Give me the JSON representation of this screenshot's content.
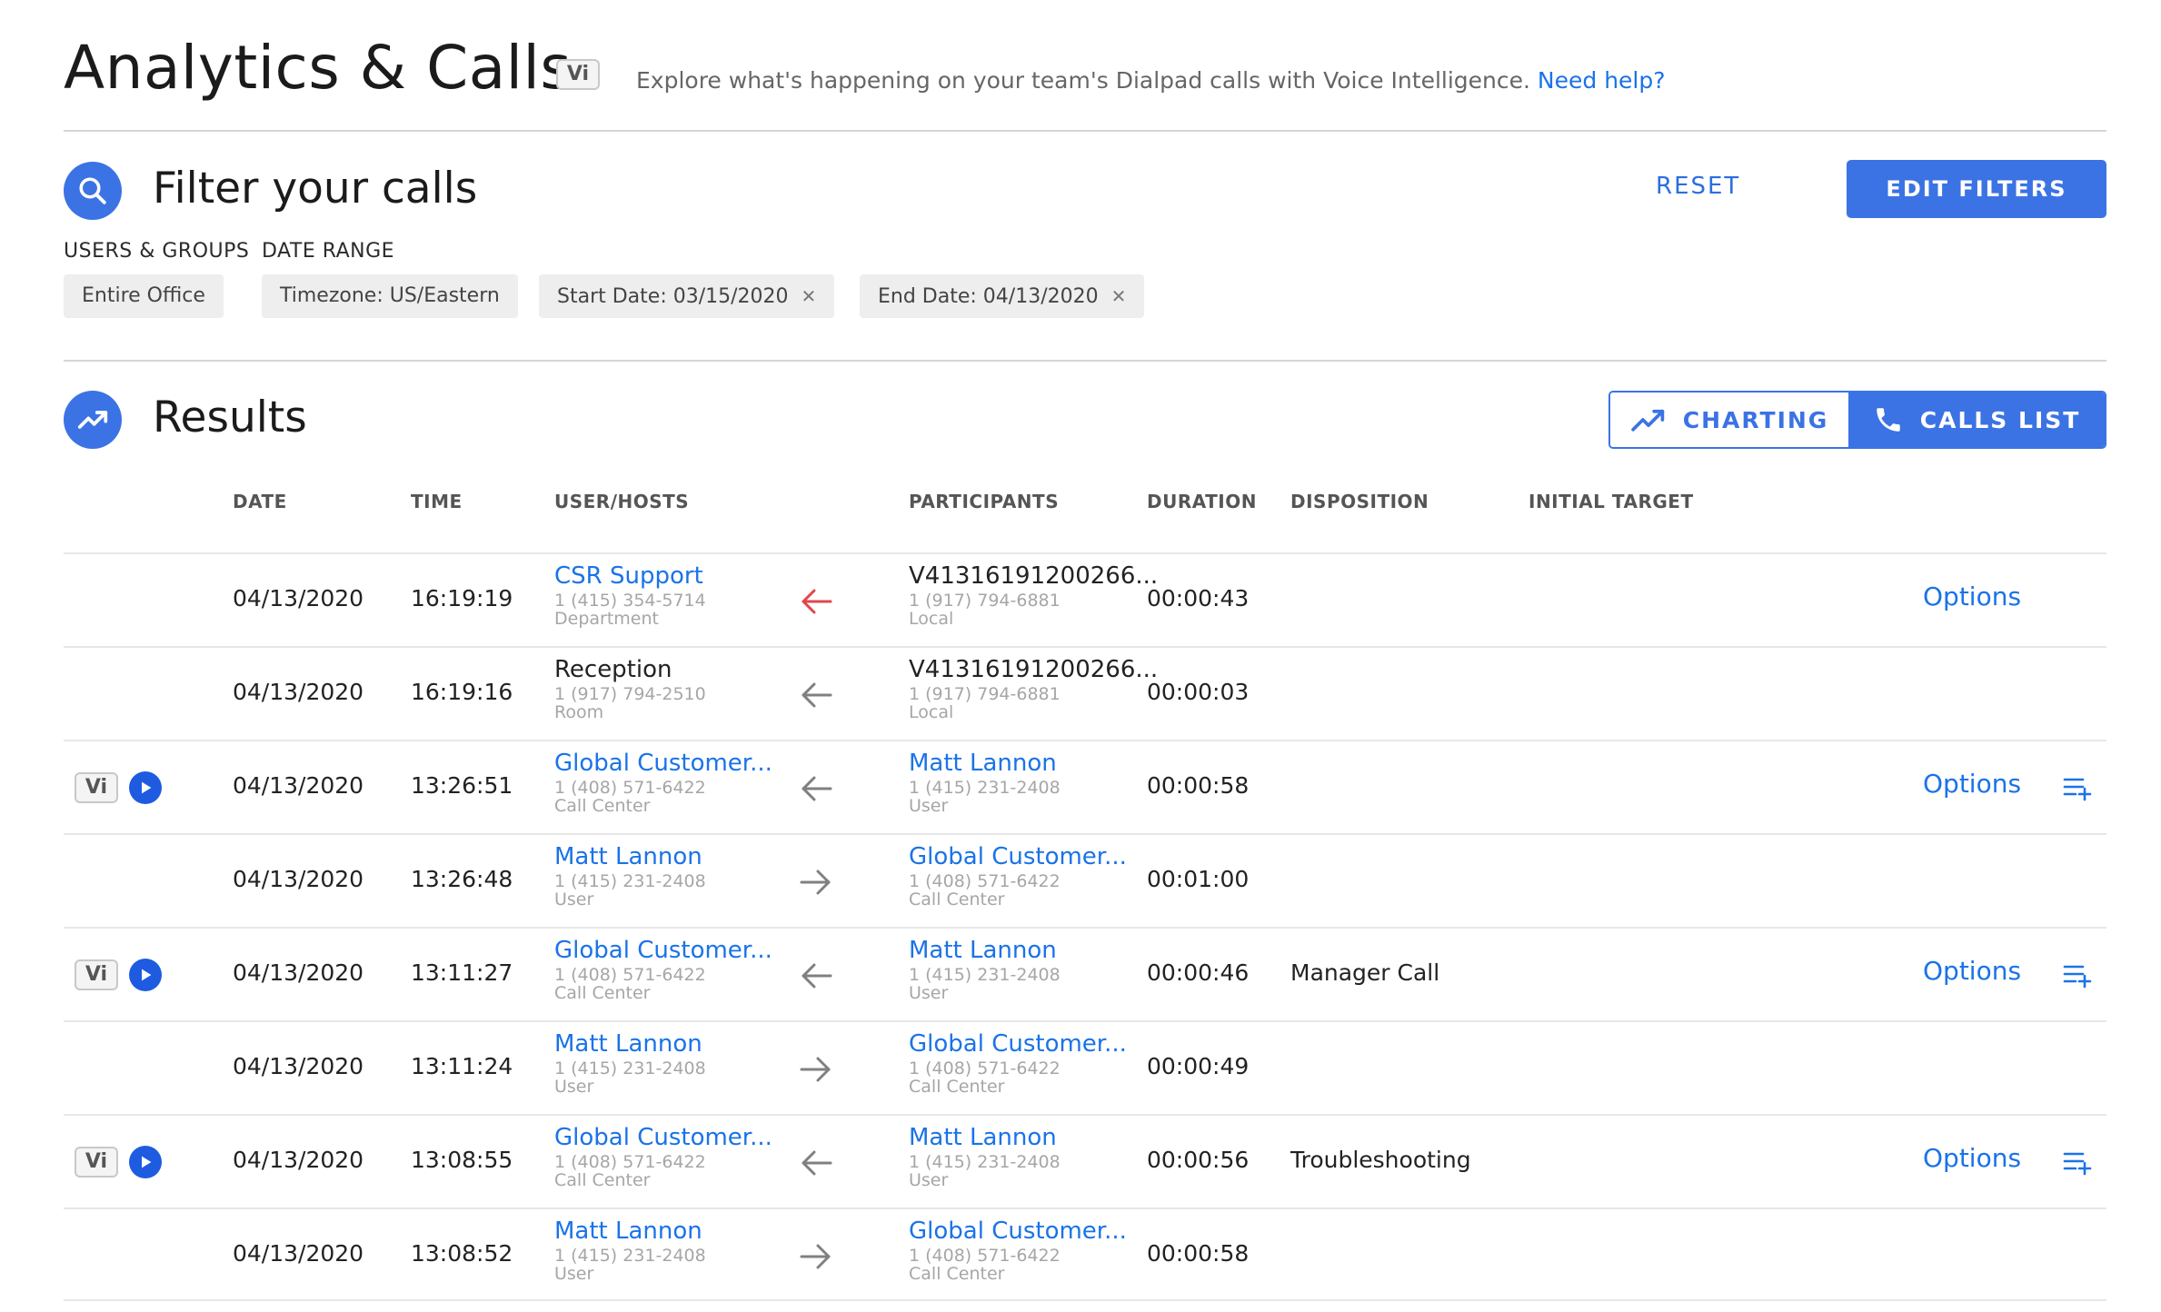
{
  "header": {
    "title": "Analytics & Calls",
    "vi_badge": "Vi",
    "subtitle": "Explore what's happening on your team's Dialpad calls with Voice Intelligence.",
    "help_link": "Need help?"
  },
  "filter": {
    "title": "Filter your calls",
    "reset_label": "RESET",
    "edit_label": "EDIT FILTERS",
    "users_groups_label": "USERS & GROUPS",
    "date_range_label": "DATE RANGE",
    "chips": {
      "office": "Entire Office",
      "timezone": "Timezone:  US/Eastern",
      "start": "Start Date:  03/15/2020",
      "end": "End Date:  04/13/2020"
    }
  },
  "results": {
    "title": "Results",
    "charting_label": "CHARTING",
    "calls_list_label": "CALLS LIST",
    "columns": {
      "date": "DATE",
      "time": "TIME",
      "hosts": "USER/HOSTS",
      "participants": "PARTICIPANTS",
      "duration": "DURATION",
      "disposition": "DISPOSITION",
      "initial_target": "INITIAL TARGET"
    },
    "options_label": "Options",
    "vi_label": "Vi",
    "rows": [
      {
        "date": "04/13/2020",
        "time": "16:19:19",
        "host": "CSR Support",
        "host_phone": "1 (415) 354-5714",
        "host_type": "Department",
        "participant": "V41316191200266...",
        "participant_phone": "1 (917) 794-6881",
        "participant_type": "Local",
        "duration": "00:00:43",
        "disposition": "",
        "direction": "in-missed"
      },
      {
        "date": "04/13/2020",
        "time": "16:19:16",
        "host": "Reception",
        "host_phone": "1 (917) 794-2510",
        "host_type": "Room",
        "participant": "V41316191200266...",
        "participant_phone": "1 (917) 794-6881",
        "participant_type": "Local",
        "duration": "00:00:03",
        "disposition": "",
        "direction": "in"
      },
      {
        "date": "04/13/2020",
        "time": "13:26:51",
        "host": "Global Customer...",
        "host_phone": "1 (408) 571-6422",
        "host_type": "Call Center",
        "participant": "Matt Lannon",
        "participant_phone": "1 (415) 231-2408",
        "participant_type": "User",
        "duration": "00:00:58",
        "disposition": "",
        "direction": "in"
      },
      {
        "date": "04/13/2020",
        "time": "13:26:48",
        "host": "Matt Lannon",
        "host_phone": "1 (415) 231-2408",
        "host_type": "User",
        "participant": "Global Customer...",
        "participant_phone": "1 (408) 571-6422",
        "participant_type": "Call Center",
        "duration": "00:01:00",
        "disposition": "",
        "direction": "out"
      },
      {
        "date": "04/13/2020",
        "time": "13:11:27",
        "host": "Global Customer...",
        "host_phone": "1 (408) 571-6422",
        "host_type": "Call Center",
        "participant": "Matt Lannon",
        "participant_phone": "1 (415) 231-2408",
        "participant_type": "User",
        "duration": "00:00:46",
        "disposition": "Manager Call",
        "direction": "in"
      },
      {
        "date": "04/13/2020",
        "time": "13:11:24",
        "host": "Matt Lannon",
        "host_phone": "1 (415) 231-2408",
        "host_type": "User",
        "participant": "Global Customer...",
        "participant_phone": "1 (408) 571-6422",
        "participant_type": "Call Center",
        "duration": "00:00:49",
        "disposition": "",
        "direction": "out"
      },
      {
        "date": "04/13/2020",
        "time": "13:08:55",
        "host": "Global Customer...",
        "host_phone": "1 (408) 571-6422",
        "host_type": "Call Center",
        "participant": "Matt Lannon",
        "participant_phone": "1 (415) 231-2408",
        "participant_type": "User",
        "duration": "00:00:56",
        "disposition": "Troubleshooting",
        "direction": "in"
      },
      {
        "date": "04/13/2020",
        "time": "13:08:52",
        "host": "Matt Lannon",
        "host_phone": "1 (415) 231-2408",
        "host_type": "User",
        "participant": "Global Customer...",
        "participant_phone": "1 (408) 571-6422",
        "participant_type": "Call Center",
        "duration": "00:00:58",
        "disposition": "",
        "direction": "out"
      }
    ]
  },
  "colors": {
    "accent": "#3b73e4",
    "link": "#1a73e8",
    "missed_arrow": "#e0474c",
    "arrow": "#808080"
  },
  "icons": {
    "search": "search-icon",
    "results": "trending-up-icon",
    "charting": "trending-up-icon",
    "calls_list": "phone-icon",
    "play": "play-icon",
    "queue": "playlist-add-icon"
  }
}
